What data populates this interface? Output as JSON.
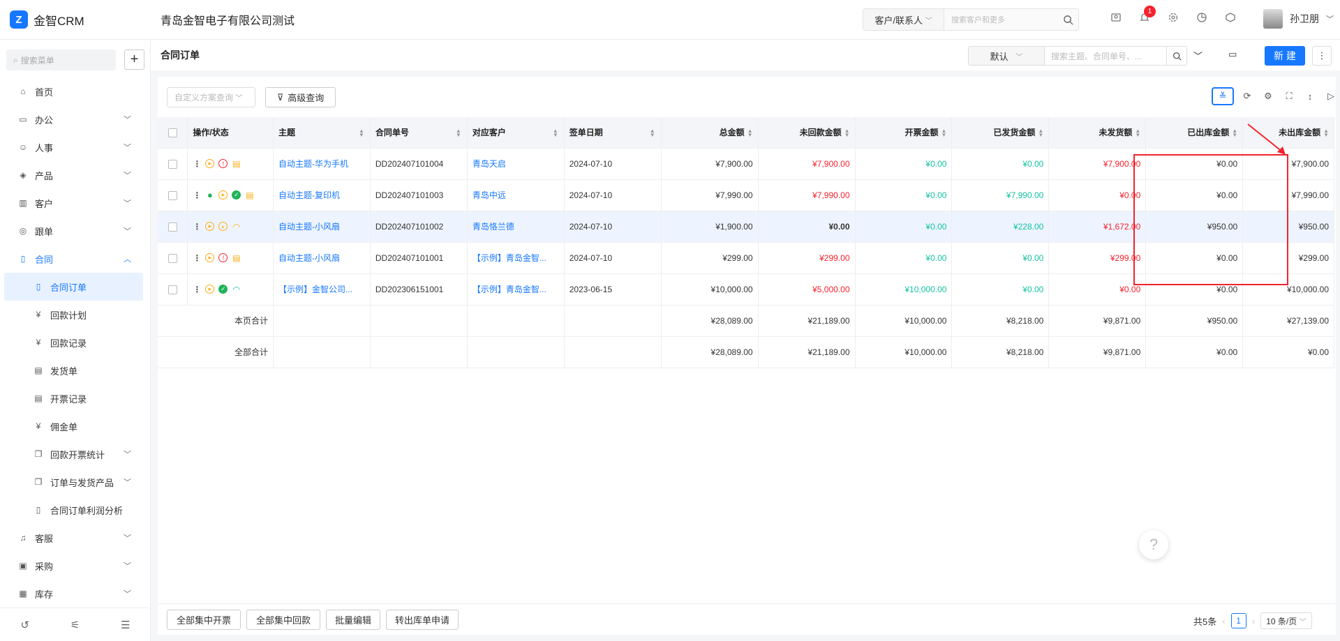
{
  "app": {
    "logo_text": "金智CRM",
    "company": "青岛金智电子有限公司测试"
  },
  "topbar": {
    "search_type": "客户/联系人",
    "search_placeholder": "搜索客户和更多",
    "notification_count": "1",
    "user_name": "孙卫朋"
  },
  "sidebar": {
    "search_placeholder": "搜索菜单",
    "items": [
      {
        "label": "首页",
        "icon": "home-icon"
      },
      {
        "label": "办公",
        "icon": "office-icon"
      },
      {
        "label": "人事",
        "icon": "people-icon"
      },
      {
        "label": "产品",
        "icon": "cube-icon"
      },
      {
        "label": "客户",
        "icon": "building-icon"
      },
      {
        "label": "跟单",
        "icon": "track-icon"
      },
      {
        "label": "合同",
        "icon": "contract-icon"
      },
      {
        "label": "合同订单",
        "icon": "doc-icon"
      },
      {
        "label": "回款计划",
        "icon": "money-icon"
      },
      {
        "label": "回款记录",
        "icon": "money-icon"
      },
      {
        "label": "发货单",
        "icon": "truck-icon"
      },
      {
        "label": "开票记录",
        "icon": "invoice-icon"
      },
      {
        "label": "佣金单",
        "icon": "money-icon"
      },
      {
        "label": "回款开票统计",
        "icon": "copy-icon"
      },
      {
        "label": "订单与发货产品",
        "icon": "copy-icon"
      },
      {
        "label": "合同订单利润分析",
        "icon": "doc-icon"
      },
      {
        "label": "客服",
        "icon": "headset-icon"
      },
      {
        "label": "采购",
        "icon": "bag-icon"
      },
      {
        "label": "库存",
        "icon": "warehouse-icon"
      }
    ]
  },
  "header": {
    "title": "合同订单",
    "view_select": "默认",
    "search_placeholder": "搜索主题、合同单号、...",
    "new_label": "新 建"
  },
  "filters": {
    "custom_query": "自定义方案查询",
    "advanced_query": "高级查询"
  },
  "table": {
    "columns": [
      "操作/状态",
      "主题",
      "合同单号",
      "对应客户",
      "签单日期",
      "总金额",
      "未回款金额",
      "开票金额",
      "已发货金额",
      "未发货额",
      "已出库金额",
      "未出库金额"
    ],
    "rows": [
      {
        "subject": "自动主题-华为手机",
        "no": "DD202407101004",
        "customer": "青岛天启",
        "date": "2024-07-10",
        "total": "¥7,900.00",
        "unpaid": "¥7,900.00",
        "invoiced": "¥0.00",
        "shipped": "¥0.00",
        "unshipped": "¥7,900.00",
        "out": "¥0.00",
        "notout": "¥7,900.00"
      },
      {
        "subject": "自动主题-复印机",
        "no": "DD202407101003",
        "customer": "青岛中远",
        "date": "2024-07-10",
        "total": "¥7,990.00",
        "unpaid": "¥7,990.00",
        "invoiced": "¥0.00",
        "shipped": "¥7,990.00",
        "unshipped": "¥0.00",
        "out": "¥0.00",
        "notout": "¥7,990.00"
      },
      {
        "subject": "自动主题-小风扇",
        "no": "DD202407101002",
        "customer": "青岛恪兰德",
        "date": "2024-07-10",
        "total": "¥1,900.00",
        "unpaid": "¥0.00",
        "invoiced": "¥0.00",
        "shipped": "¥228.00",
        "unshipped": "¥1,672.00",
        "out": "¥950.00",
        "notout": "¥950.00"
      },
      {
        "subject": "自动主题-小风扇",
        "no": "DD202407101001",
        "customer": "【示例】青岛金智...",
        "date": "2024-07-10",
        "total": "¥299.00",
        "unpaid": "¥299.00",
        "invoiced": "¥0.00",
        "shipped": "¥0.00",
        "unshipped": "¥299.00",
        "out": "¥0.00",
        "notout": "¥299.00"
      },
      {
        "subject": "【示例】金智公司...",
        "no": "DD202306151001",
        "customer": "【示例】青岛金智...",
        "date": "2023-06-15",
        "total": "¥10,000.00",
        "unpaid": "¥5,000.00",
        "invoiced": "¥10,000.00",
        "shipped": "¥0.00",
        "unshipped": "¥0.00",
        "out": "¥0.00",
        "notout": "¥10,000.00"
      }
    ],
    "page_total": {
      "label": "本页合计",
      "total": "¥28,089.00",
      "unpaid": "¥21,189.00",
      "invoiced": "¥10,000.00",
      "shipped": "¥8,218.00",
      "unshipped": "¥9,871.00",
      "out": "¥950.00",
      "notout": "¥27,139.00"
    },
    "all_total": {
      "label": "全部合计",
      "total": "¥28,089.00",
      "unpaid": "¥21,189.00",
      "invoiced": "¥10,000.00",
      "shipped": "¥8,218.00",
      "unshipped": "¥9,871.00",
      "out": "¥0.00",
      "notout": "¥0.00"
    }
  },
  "footer": {
    "buttons": [
      "全部集中开票",
      "全部集中回款",
      "批量编辑",
      "转出库单申请"
    ],
    "total_count": "共5条",
    "page": "1",
    "page_size": "10 条/页"
  },
  "colors": {
    "accent": "#1677ff",
    "red": "#f5222d",
    "green": "#13c2a2"
  }
}
